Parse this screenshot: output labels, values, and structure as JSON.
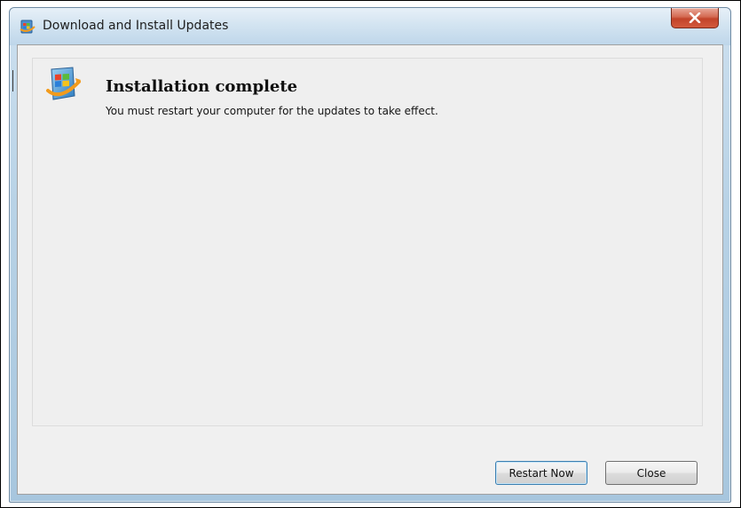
{
  "window": {
    "title": "Download and Install Updates",
    "close_glyph": "X"
  },
  "content": {
    "heading": "Installation complete",
    "message": "You must restart your computer for the updates to take effect."
  },
  "buttons": {
    "restart_label": "Restart Now",
    "close_label": "Close"
  },
  "icons": {
    "title": "windows-update-icon",
    "main": "windows-update-icon"
  },
  "colors": {
    "close_button": "#c2442a",
    "panel_background": "#f0f0f0"
  }
}
